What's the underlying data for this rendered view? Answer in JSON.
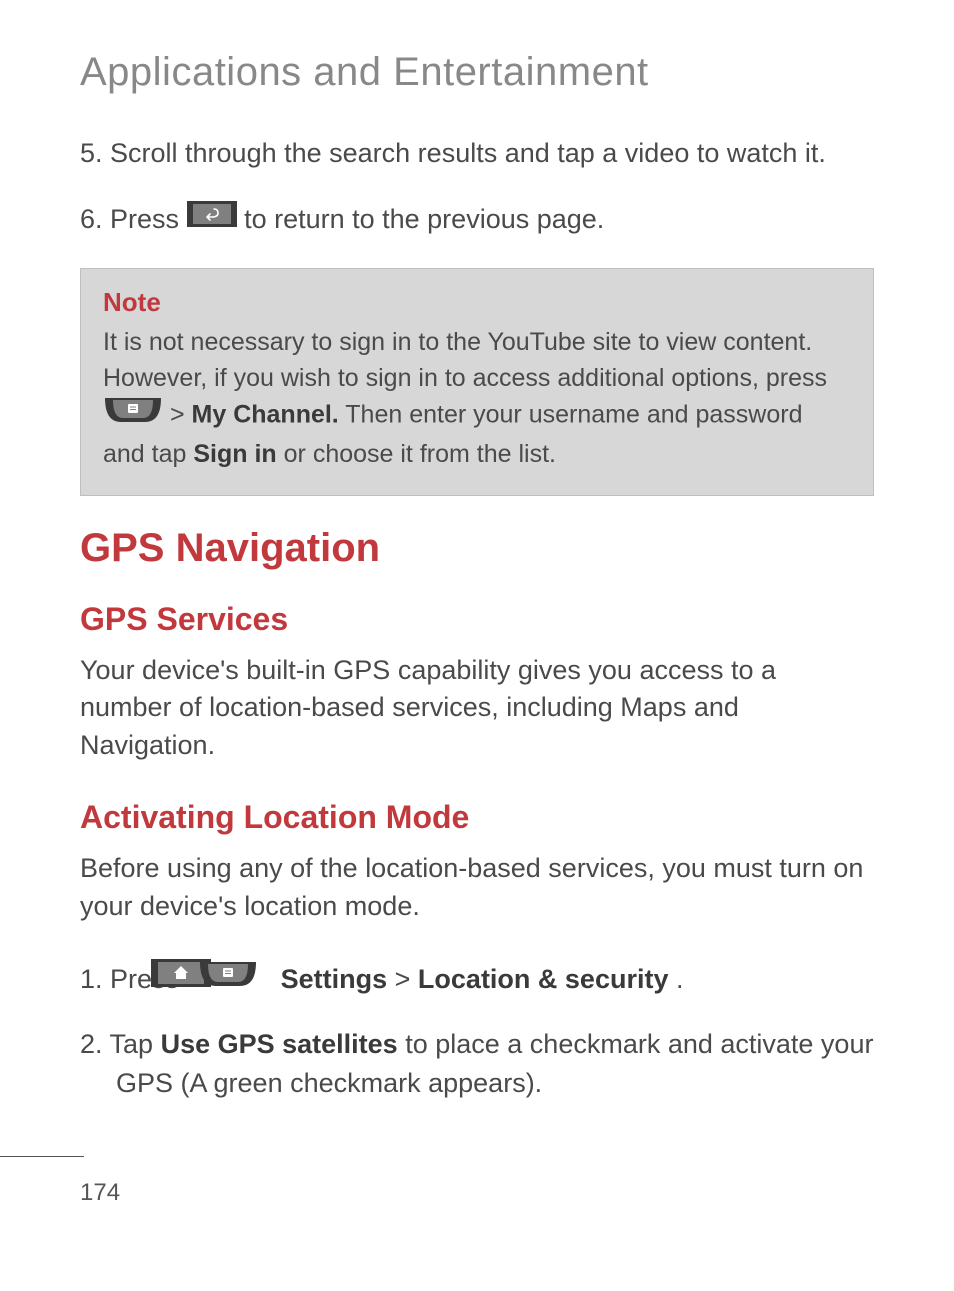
{
  "page_title": "Applications and Entertainment",
  "steps_top": {
    "s5": "5. Scroll through the search results and tap a video to watch it.",
    "s6_a": "6. Press ",
    "s6_b": " to return to the previous page."
  },
  "note": {
    "title": "Note",
    "line1": "It is not necessary to sign in to the YouTube site to view content. However, if you wish to sign in to access additional options, press ",
    "gt": " >",
    "bold_my_channel": "My Channel.",
    "line2_mid": " Then enter your username and password and tap ",
    "bold_sign_in": "Sign in",
    "line2_end": " or choose it from the list."
  },
  "gps": {
    "h2": "GPS Navigation",
    "h3_services": "GPS Services",
    "services_para": "Your device's built-in GPS capability gives you access to a number of location-based services, including Maps and Navigation.",
    "h3_activating": "Activating Location Mode",
    "activating_para": "Before using any of the location-based services, you must turn on your device's location mode.",
    "step1_a": "1. Press ",
    "step1_gt1": "  >  ",
    "step1_gt2": "  > ",
    "step1_settings": "Settings",
    "step1_gt3": " > ",
    "step1_loc": "Location & security",
    "step1_end": ".",
    "step2_a": "2. Tap ",
    "step2_bold": "Use GPS satellites",
    "step2_b": " to place a checkmark and activate your GPS (A green checkmark appears)."
  },
  "page_number": "174"
}
